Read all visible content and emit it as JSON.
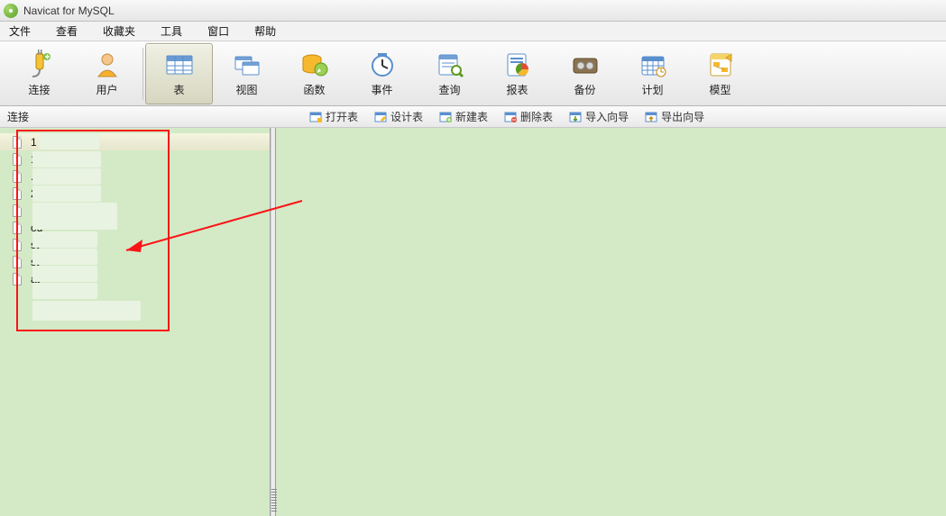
{
  "app": {
    "title": "Navicat for MySQL"
  },
  "menu": {
    "file": "文件",
    "view": "查看",
    "favorites": "收藏夹",
    "tools": "工具",
    "window": "窗口",
    "help": "帮助"
  },
  "toolbar": {
    "connect": "连接",
    "user": "用户",
    "table": "表",
    "viewobj": "视图",
    "function": "函数",
    "event": "事件",
    "query": "查询",
    "report": "报表",
    "backup": "备份",
    "schedule": "计划",
    "model": "模型"
  },
  "subbar": {
    "label": "连接",
    "open_table": "打开表",
    "design_table": "设计表",
    "new_table": "新建表",
    "delete_table": "删除表",
    "import_wizard": "导入向导",
    "export_wizard": "导出向导"
  },
  "tree": {
    "items": [
      {
        "display": "1                   5"
      },
      {
        "display": "                    1_sagc"
      },
      {
        "display": "                    .151"
      },
      {
        "display": "                    2.54"
      },
      {
        "display": ""
      },
      {
        "display": "                   od"
      },
      {
        "display": "                  st"
      },
      {
        "display": "                   st"
      },
      {
        "display": "                  at"
      }
    ]
  }
}
